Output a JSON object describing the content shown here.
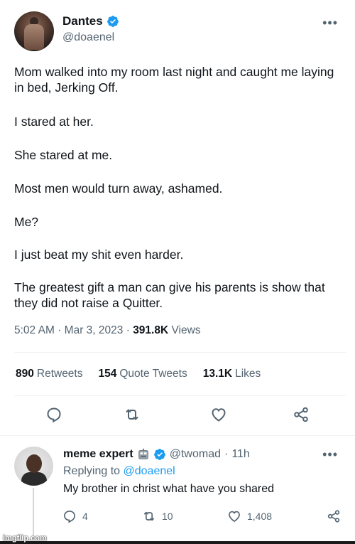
{
  "tweet": {
    "display_name": "Dantes",
    "handle": "@doaenel",
    "more_label": "•••",
    "body": [
      "Mom walked into my room last night and caught me laying in bed, Jerking Off.",
      "I stared at her.",
      "She stared at me.",
      "Most men would turn away, ashamed.",
      "Me?",
      "I just beat my shit even harder.",
      "The greatest gift a man can give his parents is show that they did not raise a Quitter."
    ],
    "time": "5:02 AM",
    "date": "Mar 3, 2023",
    "views_count": "391.8K",
    "views_label": "Views",
    "separator": "·",
    "stats": {
      "retweets_count": "890",
      "retweets_label": "Retweets",
      "quotes_count": "154",
      "quotes_label": "Quote Tweets",
      "likes_count": "13.1K",
      "likes_label": "Likes"
    }
  },
  "reply": {
    "display_name": "meme expert",
    "handle": "@twomad",
    "separator": "·",
    "age": "11h",
    "more_label": "•••",
    "replying_prefix": "Replying to",
    "replying_mention": "@doaenel",
    "text": "My brother in christ what have you shared",
    "replies_count": "4",
    "retweets_count": "10",
    "likes_count": "1,408"
  },
  "watermark": "imgflip.com",
  "colors": {
    "accent": "#1d9bf0",
    "secondary_text": "#536471",
    "primary_text": "#0f1419"
  },
  "icons": [
    "verified-badge-icon",
    "robot-emoji-icon",
    "reply-icon",
    "retweet-icon",
    "like-icon",
    "share-icon",
    "more-icon"
  ]
}
